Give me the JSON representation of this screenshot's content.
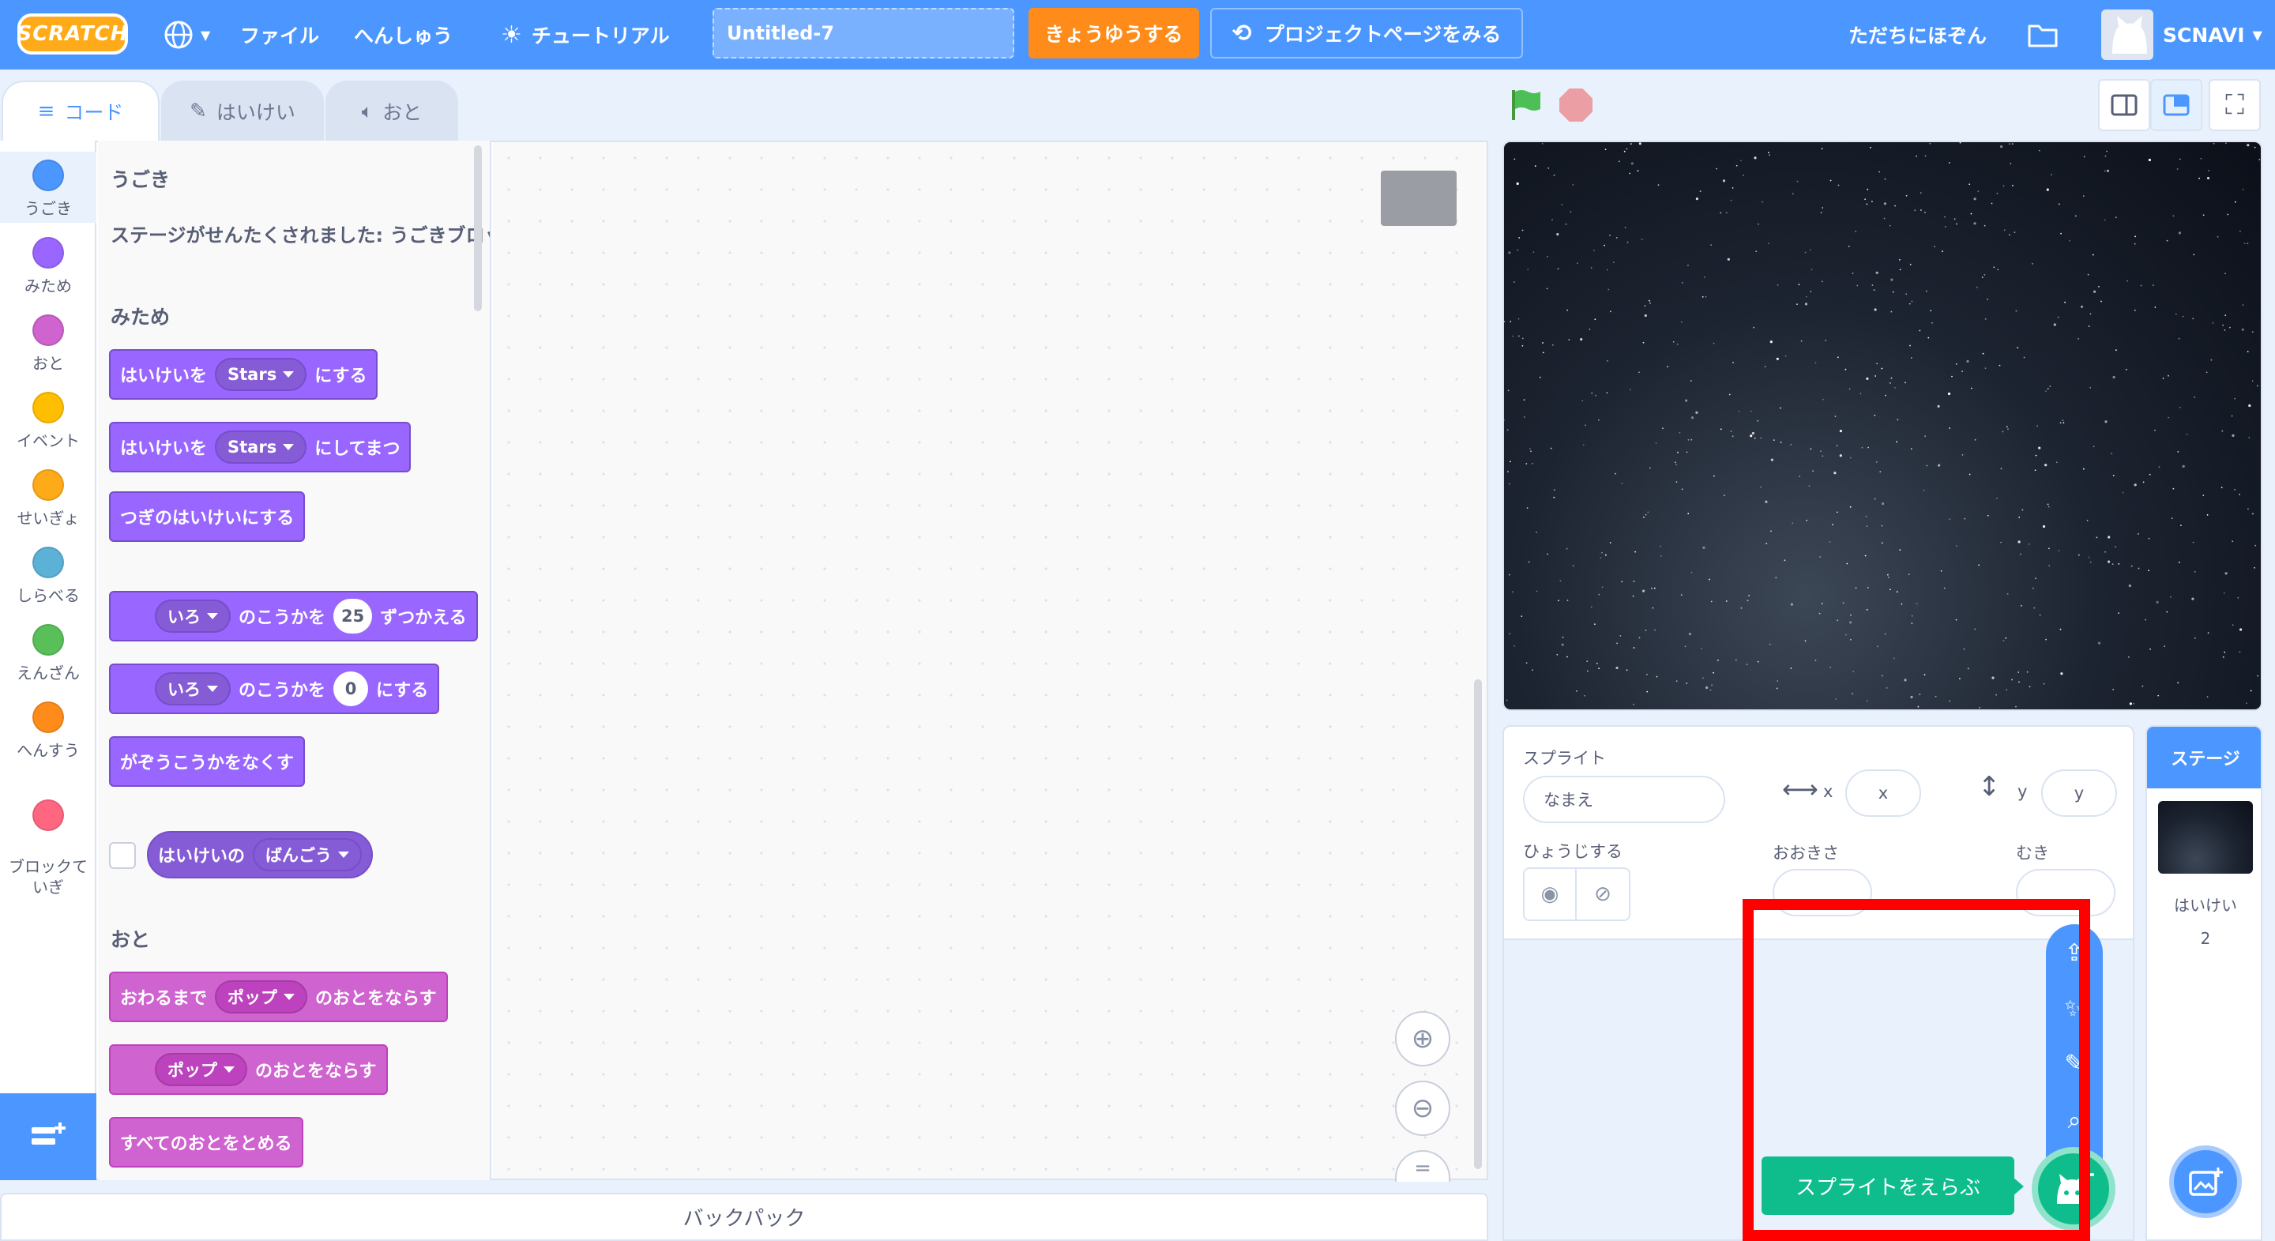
{
  "menubar": {
    "logo": "SCRATCH",
    "file": "ファイル",
    "edit": "へんしゅう",
    "tutorials": "チュートリアル",
    "project_title": "Untitled-7",
    "share": "きょうゆうする",
    "see_project_page": "プロジェクトページをみる",
    "save_now": "ただちにほぞん",
    "username": "SCNAVI"
  },
  "tabs": {
    "code": "コード",
    "costumes": "はいけい",
    "sounds": "おと"
  },
  "categories": [
    {
      "label": "うごき",
      "color": "#4c97ff"
    },
    {
      "label": "みため",
      "color": "#9966ff"
    },
    {
      "label": "おと",
      "color": "#cf63cf"
    },
    {
      "label": "イベント",
      "color": "#ffbf00"
    },
    {
      "label": "せいぎょ",
      "color": "#ffab19"
    },
    {
      "label": "しらべる",
      "color": "#5cb1d6"
    },
    {
      "label": "えんざん",
      "color": "#59c059"
    },
    {
      "label": "へんすう",
      "color": "#ff8c1a"
    },
    {
      "label": "ブロックて\nいぎ",
      "color": "#ff6680"
    }
  ],
  "palette": {
    "motion_heading": "うごき",
    "motion_note": "ステージがせんたくされました: うごきブロックはありません",
    "looks_heading": "みため",
    "blocks": {
      "switch_backdrop_pre": "はいけいを",
      "switch_backdrop_val": "Stars",
      "switch_backdrop_post": "にする",
      "switch_wait_pre": "はいけいを",
      "switch_wait_val": "Stars",
      "switch_wait_post": "にしてまつ",
      "next_backdrop": "つぎのはいけいにする",
      "change_effect_val": "いろ",
      "change_effect_mid": "のこうかを",
      "change_effect_num": "25",
      "change_effect_post": "ずつかえる",
      "set_effect_val": "いろ",
      "set_effect_mid": "のこうかを",
      "set_effect_num": "0",
      "set_effect_post": "にする",
      "clear_effects": "がぞうこうかをなくす",
      "backdrop_reporter_pre": "はいけいの",
      "backdrop_reporter_val": "ばんごう"
    },
    "sound_heading": "おと",
    "sound_blocks": {
      "play_until_pre": "おわるまで",
      "play_until_val": "ポップ",
      "play_until_post": "のおとをならす",
      "start_sound_val": "ポップ",
      "start_sound_post": "のおとをならす",
      "stop_all": "すべてのおとをとめる"
    }
  },
  "backpack": "バックパック",
  "sprite_info": {
    "sprite_label": "スプライト",
    "name_placeholder": "なまえ",
    "x_label": "x",
    "x_placeholder": "x",
    "y_label": "y",
    "y_placeholder": "y",
    "show_label": "ひょうじする",
    "size_label": "おおきさ",
    "direction_label": "むき"
  },
  "stage_pane": {
    "title": "ステージ",
    "backdrops_label": "はいけい",
    "backdrops_count": "2"
  },
  "choose_sprite_tooltip": "スプライトをえらぶ",
  "colors": {
    "menubar": "#4c97ff",
    "share": "#ff8c1a",
    "tooltip": "#0fbd8c",
    "highlight": "#ff0000"
  }
}
